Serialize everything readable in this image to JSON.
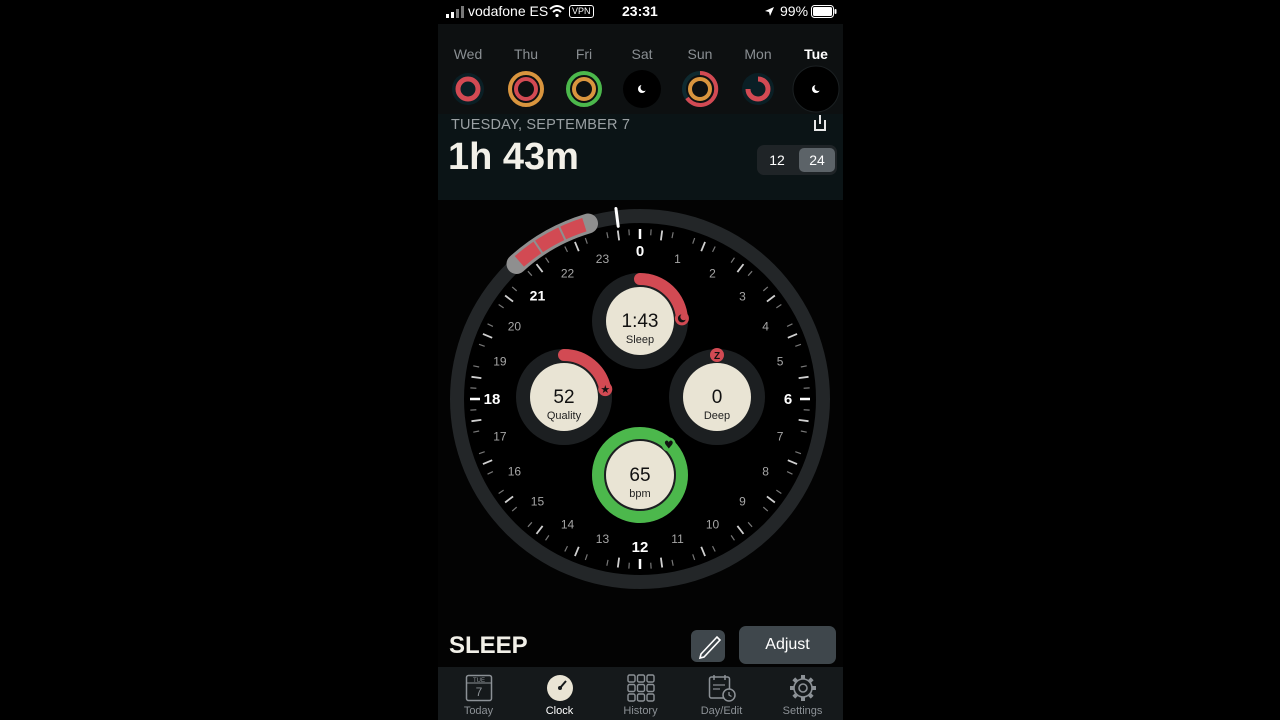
{
  "status_bar": {
    "carrier": "vodafone ES",
    "vpn": "VPN",
    "time": "23:31",
    "battery": "99%"
  },
  "week": {
    "days": [
      {
        "label": "Wed",
        "ring": "red"
      },
      {
        "label": "Thu",
        "ring": "orange"
      },
      {
        "label": "Fri",
        "ring": "green"
      },
      {
        "label": "Sat",
        "ring": "moon"
      },
      {
        "label": "Sun",
        "ring": "orange-red"
      },
      {
        "label": "Mon",
        "ring": "red"
      },
      {
        "label": "Tue",
        "ring": "moon",
        "selected": true
      }
    ]
  },
  "summary": {
    "date": "TUESDAY, SEPTEMBER 7",
    "duration": "1h 43m",
    "format_options": [
      "12",
      "24"
    ],
    "format_selected": "24"
  },
  "clock": {
    "hour_labels": [
      "0",
      "1",
      "2",
      "3",
      "4",
      "5",
      "6",
      "7",
      "8",
      "9",
      "10",
      "11",
      "12",
      "13",
      "14",
      "15",
      "16",
      "17",
      "18",
      "19",
      "20",
      "21",
      "22",
      "23"
    ],
    "sleep_arc": {
      "start_hour": 21.17,
      "end_hour": 22.9
    },
    "metrics": {
      "sleep": {
        "value": "1:43",
        "label": "Sleep",
        "icon": "moon-icon",
        "progress": 0.24
      },
      "quality": {
        "value": "52",
        "label": "Quality",
        "icon": "star-icon",
        "progress": 0.22
      },
      "deep": {
        "value": "0",
        "label": "Deep",
        "icon": "z-icon",
        "progress": 0
      },
      "heart": {
        "value": "65",
        "label": "bpm",
        "icon": "heart-icon",
        "progress": 1.0
      }
    }
  },
  "footer": {
    "title": "SLEEP",
    "adjust_label": "Adjust"
  },
  "tabs": {
    "today_icon_day": "TUE",
    "today_icon_date": "7",
    "items": [
      {
        "label": "Today",
        "icon": "calendar-icon"
      },
      {
        "label": "Clock",
        "icon": "clock-icon",
        "active": true
      },
      {
        "label": "History",
        "icon": "grid-icon"
      },
      {
        "label": "Day/Edit",
        "icon": "calendar-clock-icon"
      },
      {
        "label": "Settings",
        "icon": "gear-icon"
      }
    ]
  },
  "colors": {
    "ring_red": "#d24a53",
    "ring_orange": "#d9953e",
    "ring_green": "#4cb84c",
    "face": "#e9e4d4"
  }
}
